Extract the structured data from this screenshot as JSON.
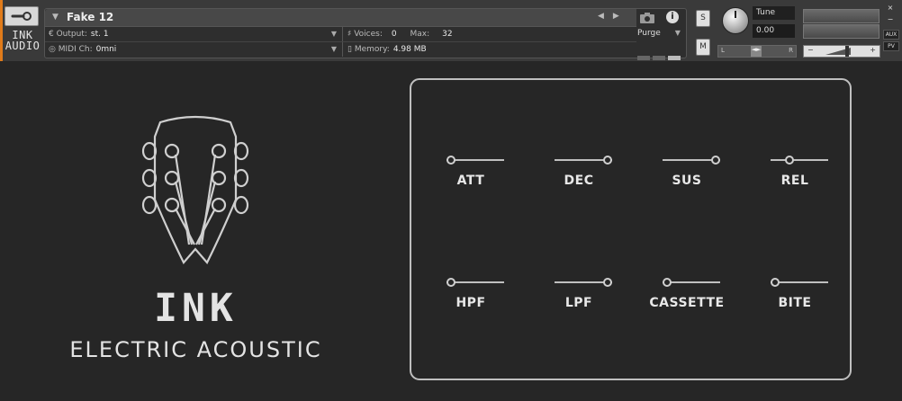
{
  "header": {
    "logo": {
      "line1": "INK",
      "line2": "AUDIO"
    },
    "instrument_title": "Fake 12",
    "output_label": "Output:",
    "output_value": "st. 1",
    "midi_label": "MIDI Ch:",
    "midi_value": "0mni",
    "voices_label": "Voices:",
    "voices_value": "0",
    "max_label": "Max:",
    "max_value": "32",
    "memory_label": "Memory:",
    "memory_value": "4.98 MB",
    "purge_label": "Purge",
    "solo_label": "S",
    "mute_label": "M",
    "tune_label": "Tune",
    "tune_value": "0.00",
    "pan_left": "L",
    "pan_right": "R",
    "vol_minus": "−",
    "vol_plus": "+",
    "close_glyph": "×",
    "min_glyph": "−",
    "aux_label": "AUX",
    "pv_label": "PV"
  },
  "branding": {
    "name": "INK",
    "product": "ELECTRIC ACOUSTIC"
  },
  "controls": [
    {
      "label": "ATT",
      "value": 0.0
    },
    {
      "label": "DEC",
      "value": 1.0
    },
    {
      "label": "SUS",
      "value": 1.0
    },
    {
      "label": "REL",
      "value": 0.3
    },
    {
      "label": "HPF",
      "value": 0.0
    },
    {
      "label": "LPF",
      "value": 1.0
    },
    {
      "label": "CASSETTE",
      "value": 0.0
    },
    {
      "label": "BITE",
      "value": 0.0
    }
  ]
}
